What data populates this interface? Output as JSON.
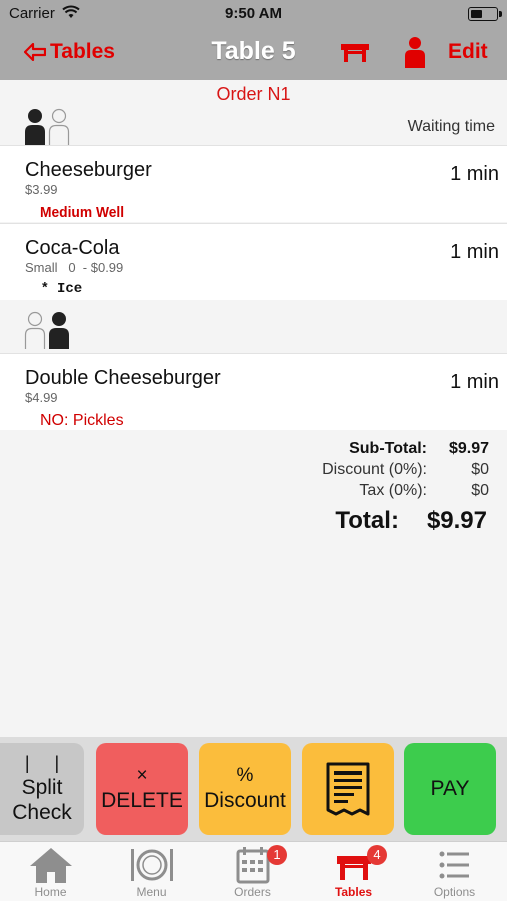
{
  "status": {
    "carrier": "Carrier",
    "time": "9:50 AM"
  },
  "nav": {
    "back_label": "Tables",
    "title": "Table 5",
    "edit_label": "Edit"
  },
  "order": {
    "title": "Order N1",
    "waiting_header": "Waiting time",
    "items": [
      {
        "name": "Cheeseburger",
        "price": "$3.99",
        "time": "1 min",
        "modifier": "Medium Well"
      },
      {
        "name": "Coca-Cola",
        "price": "Small   0  - $0.99",
        "time": "1 min",
        "modifier_star": "*",
        "modifier": "Ice"
      },
      {
        "name": "Double Cheeseburger",
        "price": "$4.99",
        "time": "1 min",
        "modifier": "NO: Pickles"
      }
    ]
  },
  "totals": {
    "subtotal_label": "Sub-Total:",
    "subtotal": "$9.97",
    "discount_label": "Discount (0%):",
    "discount": "$0",
    "tax_label": "Tax (0%):",
    "tax": "$0",
    "total_label": "Total:",
    "total": "$9.97"
  },
  "actions": {
    "split_symbol": "| |",
    "split_line1": "Split",
    "split_line2": "Check",
    "delete_symbol": "×",
    "delete_label": "DELETE",
    "discount_symbol": "%",
    "discount_label": "Discount",
    "pay_label": "PAY"
  },
  "tabs": [
    {
      "label": "Home",
      "icon": "home-icon"
    },
    {
      "label": "Menu",
      "icon": "plate-cutlery-icon"
    },
    {
      "label": "Orders",
      "icon": "calendar-icon",
      "badge": "1"
    },
    {
      "label": "Tables",
      "icon": "table-icon",
      "badge": "4"
    },
    {
      "label": "Options",
      "icon": "list-icon"
    }
  ],
  "colors": {
    "accent": "#e00000",
    "delete": "#f05e5e",
    "discount": "#fbbd3c",
    "pay": "#3dcc4d",
    "header": "#a9a9a9"
  }
}
